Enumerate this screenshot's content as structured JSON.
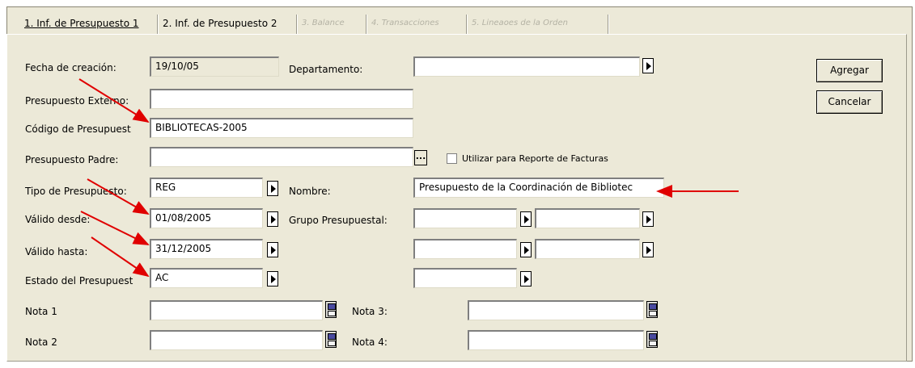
{
  "tabs": [
    {
      "label": "1. Inf. de Presupuesto 1",
      "state": "active"
    },
    {
      "label": "2. Inf. de Presupuesto 2",
      "state": "normal"
    },
    {
      "label": "3. Balance",
      "state": "disabled"
    },
    {
      "label": "4. Transacciones",
      "state": "disabled"
    },
    {
      "label": "5. Lineaoes de la Orden",
      "state": "disabled"
    }
  ],
  "form": {
    "fecha_creacion": {
      "label": "Fecha de creación:",
      "value": "19/10/05"
    },
    "departamento": {
      "label": "Departamento:",
      "value": ""
    },
    "presupuesto_externo": {
      "label": "Presupuesto Externo:",
      "value": ""
    },
    "codigo": {
      "label": "Código de Presupuest",
      "value": "BIBLIOTECAS-2005"
    },
    "padre": {
      "label": "Presupuesto Padre:",
      "value": "",
      "ellipsis": "..."
    },
    "reporte_facturas": {
      "label": "Utilizar para Reporte de Facturas",
      "checked": false
    },
    "tipo": {
      "label": "Tipo de Presupuesto:",
      "value": "REG"
    },
    "nombre": {
      "label": "Nombre:",
      "value": "Presupuesto de la Coordinación de Bibliotec"
    },
    "valido_desde": {
      "label": "Válido desde:",
      "value": "01/08/2005"
    },
    "grupo_presupuestal": {
      "label": "Grupo Presupuestal:",
      "values": [
        "",
        "",
        "",
        "",
        "",
        ""
      ]
    },
    "valido_hasta": {
      "label": "Válido hasta:",
      "value": "31/12/2005"
    },
    "estado": {
      "label": "Estado del Presupuest",
      "value": "AC"
    },
    "nota1": {
      "label": "Nota 1",
      "value": ""
    },
    "nota2": {
      "label": "Nota 2",
      "value": ""
    },
    "nota3": {
      "label": "Nota 3:",
      "value": ""
    },
    "nota4": {
      "label": "Nota 4:",
      "value": ""
    }
  },
  "buttons": {
    "agregar": "Agregar",
    "cancelar": "Cancelar"
  },
  "colors": {
    "window_bg": "#ece9d8",
    "annotation_arrow": "#e00000",
    "disabled_tab_text": "#b4b2a4"
  },
  "icons": [
    "dropdown-arrow-icon",
    "ellipsis-icon",
    "note-icon",
    "checkbox"
  ]
}
